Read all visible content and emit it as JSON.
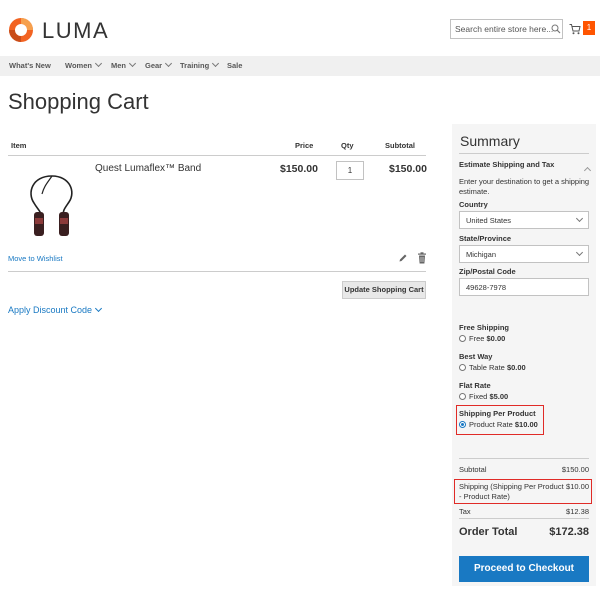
{
  "header": {
    "logo_text": "LUMA",
    "search_placeholder": "Search entire store here...",
    "cart_count": "1",
    "brand_color": "#ff5501"
  },
  "nav": {
    "items": [
      {
        "label": "What's New",
        "has_dropdown": false
      },
      {
        "label": "Women",
        "has_dropdown": true
      },
      {
        "label": "Men",
        "has_dropdown": true
      },
      {
        "label": "Gear",
        "has_dropdown": true
      },
      {
        "label": "Training",
        "has_dropdown": true
      },
      {
        "label": "Sale",
        "has_dropdown": false
      }
    ]
  },
  "page": {
    "title": "Shopping Cart"
  },
  "cart": {
    "columns": [
      "Item",
      "Price",
      "Qty",
      "Subtotal"
    ],
    "items": [
      {
        "name": "Quest Lumaflex™ Band",
        "price": "$150.00",
        "qty": "1",
        "subtotal": "$150.00"
      }
    ],
    "move_to_wishlist": "Move to Wishlist",
    "update_button": "Update Shopping Cart",
    "discount_label": "Apply Discount Code"
  },
  "summary": {
    "title": "Summary",
    "estimate_title": "Estimate Shipping and Tax",
    "estimate_desc_1": "Enter your destination to get a shipping",
    "estimate_desc_2": "estimate.",
    "country_label": "Country",
    "country_value": "United States",
    "state_label": "State/Province",
    "state_value": "Michigan",
    "zip_label": "Zip/Postal Code",
    "zip_value": "49628-7978",
    "shipping_methods": [
      {
        "title": "Free Shipping",
        "option": "Free",
        "price": "$0.00",
        "selected": false
      },
      {
        "title": "Best Way",
        "option": "Table Rate",
        "price": "$0.00",
        "selected": false
      },
      {
        "title": "Flat Rate",
        "option": "Fixed",
        "price": "$5.00",
        "selected": false
      },
      {
        "title": "Shipping Per Product",
        "option": "Product Rate",
        "price": "$10.00",
        "selected": true
      }
    ],
    "totals": {
      "subtotal_label": "Subtotal",
      "subtotal_value": "$150.00",
      "shipping_label_1": "Shipping (Shipping Per Product",
      "shipping_label_2": "- Product Rate)",
      "shipping_value": "$10.00",
      "tax_label": "Tax",
      "tax_value": "$12.38",
      "order_total_label": "Order Total",
      "order_total_value": "$172.38"
    },
    "checkout_button": "Proceed to Checkout",
    "accent_color": "#1979c3",
    "highlight_color": "#e02b27"
  }
}
